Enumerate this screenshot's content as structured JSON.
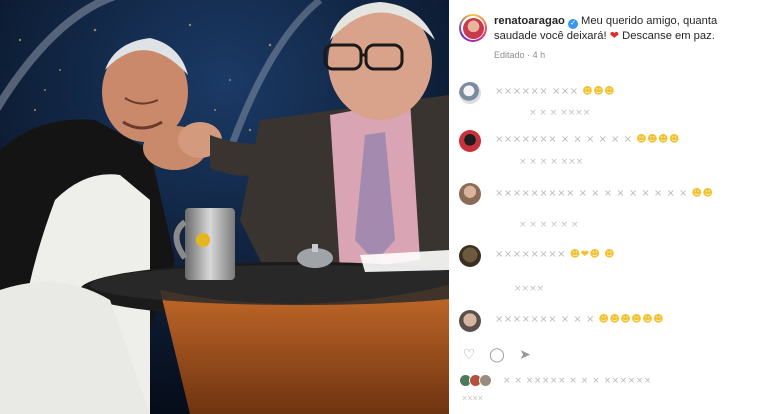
{
  "post": {
    "username": "renatoaragao",
    "caption_main": "Meu querido amigo, quanta saudade você deixará!",
    "caption_heart": "❤",
    "caption_end": "Descanse em paz.",
    "edited": "Editado",
    "separator": "·",
    "time": "4 h"
  },
  "comments": [
    {
      "text": "×××××× ×××",
      "emoji": "☻☻☻",
      "sub": "× × × ××××"
    },
    {
      "text": "××××××× × × × × × ×",
      "emoji": "☻☻☻☻",
      "sub": "× × × × ×××"
    },
    {
      "text": "××××××××× × × × × × × × × ×",
      "emoji": "☻☻",
      "sub": "× × × × × ×"
    },
    {
      "text": "××××××××",
      "emoji": "☻❤☻ ☻",
      "sub": "××××"
    },
    {
      "text": "××××××× × × ×",
      "emoji": "☻☻☻☻☻☻",
      "sub": ""
    }
  ],
  "actions": {
    "like_icon": "heart-outline-icon",
    "comment_icon": "comment-icon",
    "share_icon": "send-icon",
    "like_glyph": "♡",
    "comment_glyph": "◯",
    "share_glyph": "➤"
  },
  "likes_text": "× × ××××× × × × ××××××",
  "date_text": "××××",
  "colors": {
    "verified": "#3897f0",
    "heart": "#e2262b",
    "meta_gray": "#8e8e8e"
  }
}
